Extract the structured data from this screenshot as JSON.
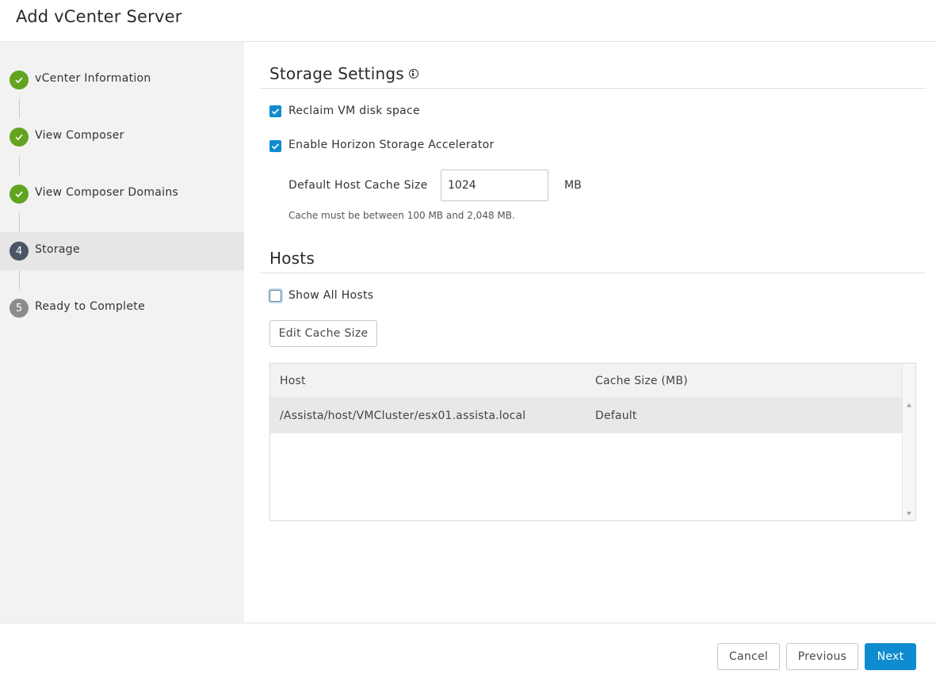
{
  "header": {
    "title": "Add vCenter Server"
  },
  "sidebar": {
    "steps": [
      {
        "label": "vCenter Information",
        "status": "complete",
        "badge": "check-icon"
      },
      {
        "label": "View Composer",
        "status": "complete",
        "badge": "check-icon"
      },
      {
        "label": "View Composer Domains",
        "status": "complete",
        "badge": "check-icon"
      },
      {
        "label": "Storage",
        "status": "current",
        "badge": "4"
      },
      {
        "label": "Ready to Complete",
        "status": "pending",
        "badge": "5"
      }
    ]
  },
  "storage": {
    "title": "Storage Settings",
    "reclaim_label": "Reclaim VM disk space",
    "reclaim_checked": true,
    "accelerator_label": "Enable Horizon Storage Accelerator",
    "accelerator_checked": true,
    "cache_label": "Default Host Cache Size",
    "cache_value": "1024",
    "cache_unit": "MB",
    "cache_help": "Cache must be between 100 MB and 2,048 MB."
  },
  "hosts": {
    "title": "Hosts",
    "show_all_label": "Show All Hosts",
    "show_all_checked": false,
    "edit_button": "Edit Cache Size",
    "columns": [
      "Host",
      "Cache Size (MB)"
    ],
    "rows": [
      {
        "host": "/Assista/host/VMCluster/esx01.assista.local",
        "cache": "Default"
      }
    ]
  },
  "footer": {
    "cancel": "Cancel",
    "previous": "Previous",
    "next": "Next"
  },
  "colors": {
    "accent": "#0e8ccf",
    "complete": "#62a420",
    "current": "#4b5563",
    "pending": "#8c8c8c"
  }
}
